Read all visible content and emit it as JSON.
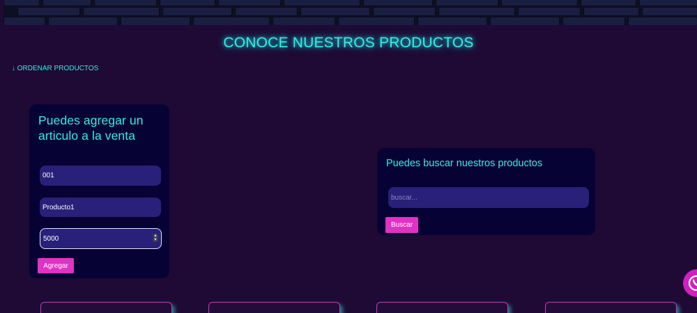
{
  "page": {
    "title": "CONOCE NUESTROS PRODUCTOS",
    "sort_link": "↓ ORDENAR PRODUCTOS"
  },
  "add_card": {
    "title": "Puedes agregar un articulo a la venta",
    "code_value": "001",
    "name_value": "Producto1",
    "price_value": "5000",
    "button_label": "Agregar"
  },
  "search_card": {
    "title": "Puedes buscar nuestros productos",
    "search_placeholder": "buscar...",
    "button_label": "Buscar"
  },
  "colors": {
    "background": "#1e0a34",
    "accent_cyan": "#33f0e0",
    "button_magenta": "#e032c5",
    "card_bg": "#070234",
    "input_bg": "#29207a"
  },
  "icons": {
    "whatsapp": "whatsapp-icon"
  }
}
